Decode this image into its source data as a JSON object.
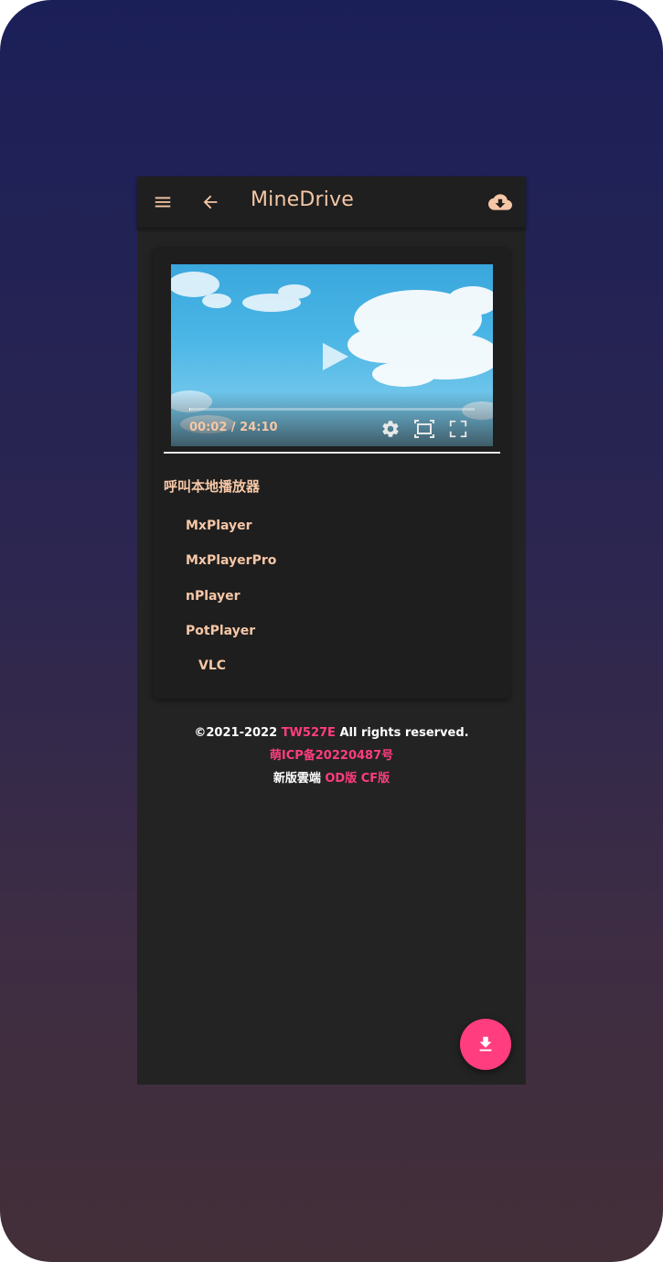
{
  "appbar": {
    "title": "MineDrive",
    "icons": {
      "menu": "menu-icon",
      "back": "arrow-left-icon",
      "cloud": "cloud-download-icon"
    },
    "title_color": "#f6c7a6"
  },
  "video": {
    "time": "00:02 / 24:10",
    "progress_fraction": 0.0014,
    "icons": {
      "play": "play-icon",
      "settings": "gear-icon",
      "pip": "picture-in-picture-icon",
      "fullscreen": "fullscreen-icon"
    }
  },
  "players": {
    "title": "呼叫本地播放器",
    "items": [
      "MxPlayer",
      "MxPlayerPro",
      "nPlayer",
      "PotPlayer",
      "VLC"
    ]
  },
  "footer": {
    "copyright_prefix": "©2021-2022",
    "author": "TW527E",
    "rights": "All rights reserved.",
    "icp": "萌ICP备20220487号",
    "new_version_label": "新版雲端",
    "od_link": "OD版",
    "cf_link": "CF版"
  },
  "fab": {
    "icon": "download-icon"
  },
  "colors": {
    "accent": "#ff3d7f",
    "text_peach": "#f6c7a6",
    "card_bg": "#1e1e1e",
    "app_bg": "#232323"
  }
}
